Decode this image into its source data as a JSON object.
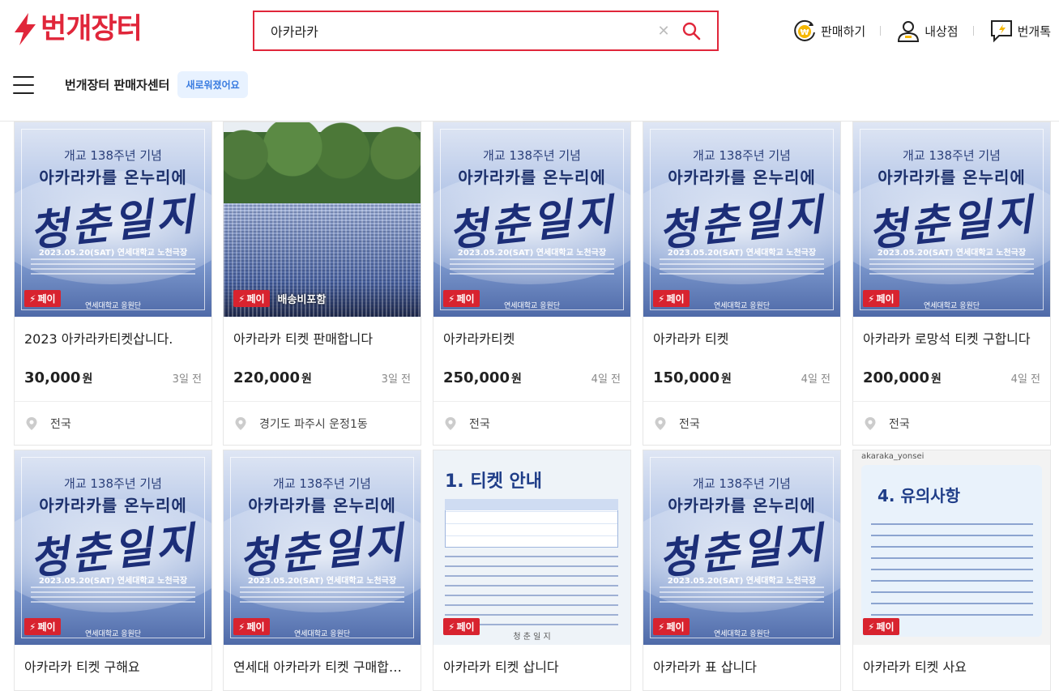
{
  "header": {
    "logo_text": "번개장터",
    "search_value": "아카라카",
    "actions": [
      {
        "label": "판매하기",
        "icon": "won-coin-icon"
      },
      {
        "label": "내상점",
        "icon": "user-icon"
      },
      {
        "label": "번개톡",
        "icon": "chat-icon"
      }
    ],
    "seller_center": "번개장터 판매자센터",
    "new_badge": "새로워졌어요"
  },
  "colors": {
    "brand": "#e0263a",
    "pay_badge": "#d8232f"
  },
  "poster": {
    "line1": "개교 138주년 기념",
    "line2": "아카라카를 온누리에",
    "line3": "청춘일지",
    "line4": "2023.05.20(SAT) 연세대학교 노천극장",
    "footer": "연세대학교 응원단"
  },
  "info_poster_1": {
    "heading": "1. 티켓 안내",
    "caption": "청 춘 일 지"
  },
  "info_poster_2": {
    "account": "akaraka_yonsei",
    "heading": "4. 유의사항"
  },
  "products": [
    {
      "title": "2023 아카라카티켓삽니다.",
      "price": "30,000",
      "unit": "원",
      "time": "3일 전",
      "location": "전국",
      "badge": "페이",
      "shipping": "",
      "image": "poster"
    },
    {
      "title": "아카라카 티켓 판매합니다",
      "price": "220,000",
      "unit": "원",
      "time": "3일 전",
      "location": "경기도 파주시 운정1동",
      "badge": "페이",
      "shipping": "배송비포함",
      "image": "crowd"
    },
    {
      "title": "아카라카티켓",
      "price": "250,000",
      "unit": "원",
      "time": "4일 전",
      "location": "전국",
      "badge": "페이",
      "shipping": "",
      "image": "poster"
    },
    {
      "title": "아카라카 티켓",
      "price": "150,000",
      "unit": "원",
      "time": "4일 전",
      "location": "전국",
      "badge": "페이",
      "shipping": "",
      "image": "poster"
    },
    {
      "title": "아카라카 로망석 티켓 구합니다",
      "price": "200,000",
      "unit": "원",
      "time": "4일 전",
      "location": "전국",
      "badge": "페이",
      "shipping": "",
      "image": "poster"
    },
    {
      "title": "아카라카 티켓 구해요",
      "price": "",
      "unit": "",
      "time": "",
      "location": "",
      "badge": "페이",
      "shipping": "",
      "image": "poster"
    },
    {
      "title": "연세대 아카라카 티켓 구매합니다",
      "price": "",
      "unit": "",
      "time": "",
      "location": "",
      "badge": "페이",
      "shipping": "",
      "image": "poster"
    },
    {
      "title": "아카라카 티켓 삽니다",
      "price": "",
      "unit": "",
      "time": "",
      "location": "",
      "badge": "페이",
      "shipping": "",
      "image": "info1"
    },
    {
      "title": "아카라카 표 삽니다",
      "price": "",
      "unit": "",
      "time": "",
      "location": "",
      "badge": "페이",
      "shipping": "",
      "image": "poster"
    },
    {
      "title": "아카라카 티켓 사요",
      "price": "",
      "unit": "",
      "time": "",
      "location": "",
      "badge": "페이",
      "shipping": "",
      "image": "info2"
    }
  ]
}
